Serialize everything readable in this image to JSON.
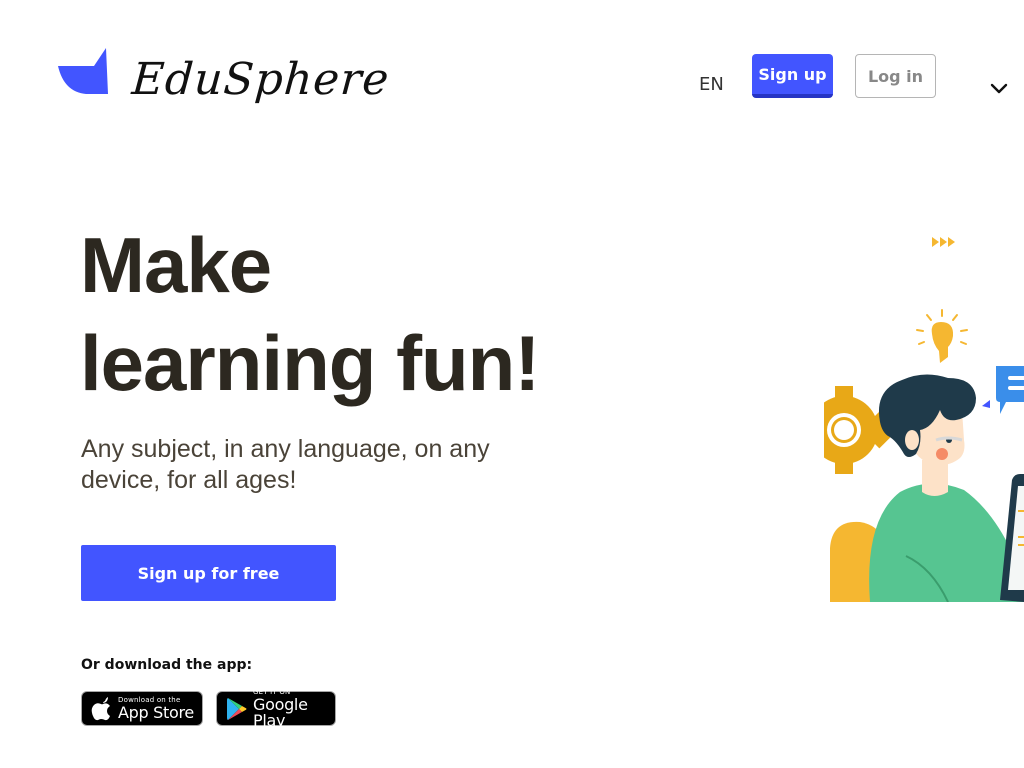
{
  "header": {
    "brand_name": "EduSphere",
    "language": "EN",
    "signup_label": "Sign up",
    "login_label": "Log in",
    "menu_icon": "chevron-down-icon"
  },
  "hero": {
    "title_line1": "Make",
    "title_line2": "learning fun!",
    "subtitle": "Any subject, in any language, on any device, for all ages!",
    "cta_label": "Sign up for free"
  },
  "download": {
    "label": "Or download the app:",
    "app_store": {
      "small": "Download on the",
      "big": "App Store",
      "icon": "apple-icon"
    },
    "google_play": {
      "small": "GET IT ON",
      "big": "Google Play",
      "icon": "play-triangle-icon"
    }
  },
  "colors": {
    "accent": "#4255ff",
    "accent_dark": "#2634c4",
    "title_text": "#2c2820",
    "illustration_yellow": "#f5b731",
    "illustration_green": "#56c591",
    "illustration_hair": "#1f3a4a"
  }
}
